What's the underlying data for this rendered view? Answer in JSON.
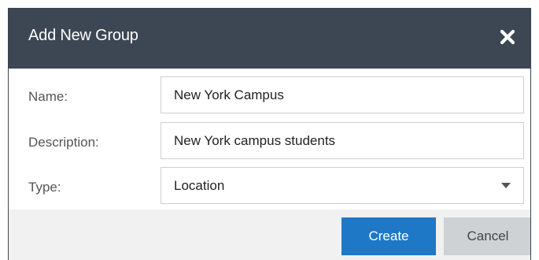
{
  "dialog": {
    "title": "Add New Group",
    "close_icon": "close-icon"
  },
  "form": {
    "name": {
      "label": "Name:",
      "value": "New York Campus"
    },
    "description": {
      "label": "Description:",
      "value": "New York campus students"
    },
    "type": {
      "label": "Type:",
      "value": "Location",
      "icon": "chevron-down-icon"
    }
  },
  "footer": {
    "create_label": "Create",
    "cancel_label": "Cancel"
  },
  "colors": {
    "header_bg": "#3d4653",
    "primary_button": "#1f78c6",
    "secondary_button": "#cfd2d4",
    "footer_bg": "#f1f1f1"
  }
}
